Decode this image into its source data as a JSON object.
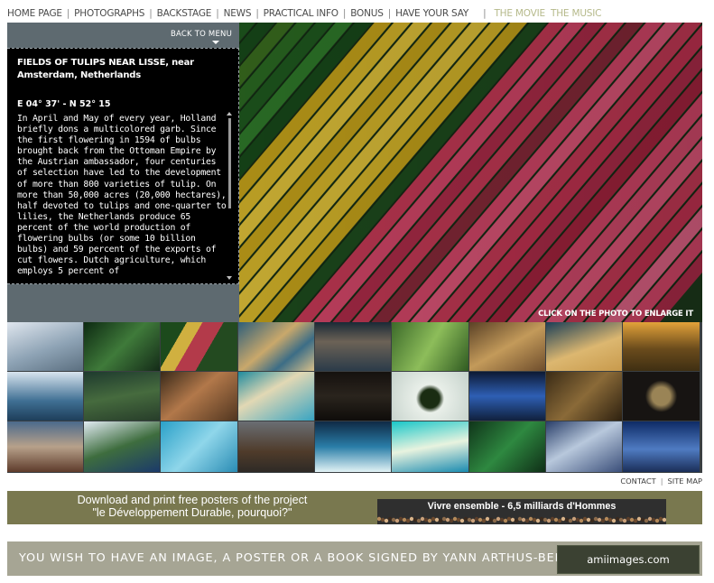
{
  "nav": {
    "items": [
      "HOME PAGE",
      "PHOTOGRAPHS",
      "BACKSTAGE",
      "NEWS",
      "PRACTICAL INFO",
      "BONUS",
      "HAVE YOUR SAY"
    ],
    "secondary": [
      "THE MOVIE",
      "THE MUSIC"
    ]
  },
  "viewer": {
    "back_label": "BACK TO MENU",
    "title": "FIELDS OF TULIPS NEAR LISSE, near Amsterdam, Netherlands",
    "coordinates": "E 04° 37' - N 52° 15",
    "description": "In April and May of every year, Holland briefly dons a multicolored garb. Since the first flowering in 1594 of bulbs brought back from the Ottoman Empire by the Austrian ambassador, four centuries of selection have led to the development of more than 800 varieties of tulip. On more than 50,000 acres (20,000 hectares), half devoted to tulips and one-quarter to lilies, the Netherlands produce 65 percent of the world production of flowering bulbs (or some 10 billion bulbs) and 59 percent of the exports of cut flowers. Dutch agriculture, which employs 5 percent of",
    "enlarge_label": "CLICK ON THE PHOTO TO ENLARGE IT"
  },
  "footer_links": [
    "CONTACT",
    "SITE MAP"
  ],
  "poster_banner": {
    "line1": "Download and print free posters of the project",
    "line2": "\"le Développement Durable, pourquoi?\"",
    "box_title": "Vivre ensemble - 6,5 milliards d'Hommes"
  },
  "signed_banner": {
    "text": "YOU WISH TO HAVE AN IMAGE, A POSTER OR A BOOK SIGNED BY YANN ARTHUS-BERTRAND ......",
    "box_text": "amiimages.com"
  },
  "colors": {
    "panel": "#5e6a70",
    "banner_olive": "#79784f",
    "banner_gray": "#a6a594"
  }
}
